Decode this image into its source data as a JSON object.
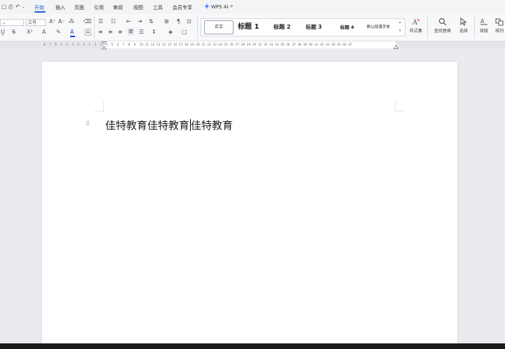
{
  "menu": {
    "tabs": [
      "开始",
      "插入",
      "页面",
      "引用",
      "审阅",
      "视图",
      "工具",
      "会员专享"
    ],
    "ai_label": "WPS AI"
  },
  "ribbon": {
    "font_size": "三号",
    "styles": [
      "正文",
      "标题 1",
      "标题 2",
      "标题 3",
      "标题 4",
      "默认段落字体"
    ],
    "right_tools": {
      "style_set": "样式集",
      "find_replace": "查找替换",
      "select": "选择",
      "layout": "排版",
      "arrange": "排列"
    }
  },
  "ruler": {
    "numbers": [
      "8",
      "7",
      "6",
      "5",
      "4",
      "3",
      "2",
      "1",
      "1",
      "2",
      "3",
      "4",
      "5",
      "6",
      "7",
      "8",
      "9",
      "10",
      "11",
      "12",
      "13",
      "14",
      "15",
      "16",
      "17",
      "18",
      "19",
      "20",
      "21",
      "22",
      "23",
      "24",
      "25",
      "26",
      "27",
      "28",
      "29",
      "30",
      "31",
      "32",
      "33",
      "34",
      "35",
      "36",
      "37",
      "38",
      "39",
      "40",
      "41",
      "42",
      "43",
      "44",
      "45",
      "46",
      "47"
    ]
  },
  "document": {
    "text_before_cursor": "佳特教育佳特教育",
    "text_after_cursor": "佳特教育"
  },
  "colors": {
    "accent": "#1f5fd8",
    "page": "#ffffff",
    "canvas": "#e9ebee"
  }
}
